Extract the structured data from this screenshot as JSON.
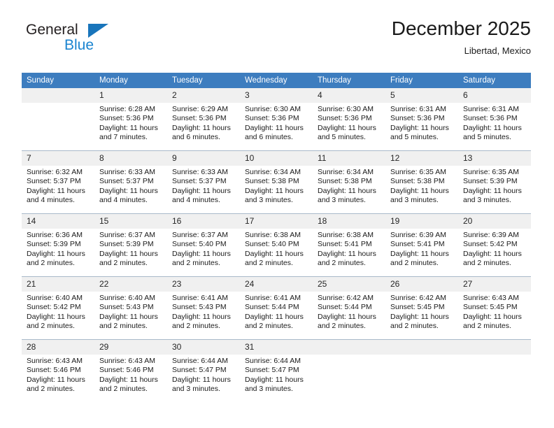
{
  "brand": {
    "name_top": "General",
    "name_bottom": "Blue",
    "triangle_color": "#1975bb",
    "blue_color": "#1b84d0"
  },
  "header": {
    "title": "December 2025",
    "subtitle": "Libertad, Mexico"
  },
  "theme": {
    "header_bg": "#3d7dbf",
    "header_text": "#ffffff",
    "daynum_bg": "#f0f0f0",
    "cell_bg": "#ffffff",
    "grid_line": "#a9b9c9"
  },
  "weekdays": [
    "Sunday",
    "Monday",
    "Tuesday",
    "Wednesday",
    "Thursday",
    "Friday",
    "Saturday"
  ],
  "labels": {
    "sunrise_prefix": "Sunrise:",
    "sunset_prefix": "Sunset:",
    "daylight_prefix": "Daylight:"
  },
  "weeks": [
    [
      {
        "day": "",
        "blank": true
      },
      {
        "day": "1",
        "sunrise": "Sunrise: 6:28 AM",
        "sunset": "Sunset: 5:36 PM",
        "daylight1": "Daylight: 11 hours",
        "daylight2": "and 7 minutes."
      },
      {
        "day": "2",
        "sunrise": "Sunrise: 6:29 AM",
        "sunset": "Sunset: 5:36 PM",
        "daylight1": "Daylight: 11 hours",
        "daylight2": "and 6 minutes."
      },
      {
        "day": "3",
        "sunrise": "Sunrise: 6:30 AM",
        "sunset": "Sunset: 5:36 PM",
        "daylight1": "Daylight: 11 hours",
        "daylight2": "and 6 minutes."
      },
      {
        "day": "4",
        "sunrise": "Sunrise: 6:30 AM",
        "sunset": "Sunset: 5:36 PM",
        "daylight1": "Daylight: 11 hours",
        "daylight2": "and 5 minutes."
      },
      {
        "day": "5",
        "sunrise": "Sunrise: 6:31 AM",
        "sunset": "Sunset: 5:36 PM",
        "daylight1": "Daylight: 11 hours",
        "daylight2": "and 5 minutes."
      },
      {
        "day": "6",
        "sunrise": "Sunrise: 6:31 AM",
        "sunset": "Sunset: 5:36 PM",
        "daylight1": "Daylight: 11 hours",
        "daylight2": "and 5 minutes."
      }
    ],
    [
      {
        "day": "7",
        "sunrise": "Sunrise: 6:32 AM",
        "sunset": "Sunset: 5:37 PM",
        "daylight1": "Daylight: 11 hours",
        "daylight2": "and 4 minutes."
      },
      {
        "day": "8",
        "sunrise": "Sunrise: 6:33 AM",
        "sunset": "Sunset: 5:37 PM",
        "daylight1": "Daylight: 11 hours",
        "daylight2": "and 4 minutes."
      },
      {
        "day": "9",
        "sunrise": "Sunrise: 6:33 AM",
        "sunset": "Sunset: 5:37 PM",
        "daylight1": "Daylight: 11 hours",
        "daylight2": "and 4 minutes."
      },
      {
        "day": "10",
        "sunrise": "Sunrise: 6:34 AM",
        "sunset": "Sunset: 5:38 PM",
        "daylight1": "Daylight: 11 hours",
        "daylight2": "and 3 minutes."
      },
      {
        "day": "11",
        "sunrise": "Sunrise: 6:34 AM",
        "sunset": "Sunset: 5:38 PM",
        "daylight1": "Daylight: 11 hours",
        "daylight2": "and 3 minutes."
      },
      {
        "day": "12",
        "sunrise": "Sunrise: 6:35 AM",
        "sunset": "Sunset: 5:38 PM",
        "daylight1": "Daylight: 11 hours",
        "daylight2": "and 3 minutes."
      },
      {
        "day": "13",
        "sunrise": "Sunrise: 6:35 AM",
        "sunset": "Sunset: 5:39 PM",
        "daylight1": "Daylight: 11 hours",
        "daylight2": "and 3 minutes."
      }
    ],
    [
      {
        "day": "14",
        "sunrise": "Sunrise: 6:36 AM",
        "sunset": "Sunset: 5:39 PM",
        "daylight1": "Daylight: 11 hours",
        "daylight2": "and 2 minutes."
      },
      {
        "day": "15",
        "sunrise": "Sunrise: 6:37 AM",
        "sunset": "Sunset: 5:39 PM",
        "daylight1": "Daylight: 11 hours",
        "daylight2": "and 2 minutes."
      },
      {
        "day": "16",
        "sunrise": "Sunrise: 6:37 AM",
        "sunset": "Sunset: 5:40 PM",
        "daylight1": "Daylight: 11 hours",
        "daylight2": "and 2 minutes."
      },
      {
        "day": "17",
        "sunrise": "Sunrise: 6:38 AM",
        "sunset": "Sunset: 5:40 PM",
        "daylight1": "Daylight: 11 hours",
        "daylight2": "and 2 minutes."
      },
      {
        "day": "18",
        "sunrise": "Sunrise: 6:38 AM",
        "sunset": "Sunset: 5:41 PM",
        "daylight1": "Daylight: 11 hours",
        "daylight2": "and 2 minutes."
      },
      {
        "day": "19",
        "sunrise": "Sunrise: 6:39 AM",
        "sunset": "Sunset: 5:41 PM",
        "daylight1": "Daylight: 11 hours",
        "daylight2": "and 2 minutes."
      },
      {
        "day": "20",
        "sunrise": "Sunrise: 6:39 AM",
        "sunset": "Sunset: 5:42 PM",
        "daylight1": "Daylight: 11 hours",
        "daylight2": "and 2 minutes."
      }
    ],
    [
      {
        "day": "21",
        "sunrise": "Sunrise: 6:40 AM",
        "sunset": "Sunset: 5:42 PM",
        "daylight1": "Daylight: 11 hours",
        "daylight2": "and 2 minutes."
      },
      {
        "day": "22",
        "sunrise": "Sunrise: 6:40 AM",
        "sunset": "Sunset: 5:43 PM",
        "daylight1": "Daylight: 11 hours",
        "daylight2": "and 2 minutes."
      },
      {
        "day": "23",
        "sunrise": "Sunrise: 6:41 AM",
        "sunset": "Sunset: 5:43 PM",
        "daylight1": "Daylight: 11 hours",
        "daylight2": "and 2 minutes."
      },
      {
        "day": "24",
        "sunrise": "Sunrise: 6:41 AM",
        "sunset": "Sunset: 5:44 PM",
        "daylight1": "Daylight: 11 hours",
        "daylight2": "and 2 minutes."
      },
      {
        "day": "25",
        "sunrise": "Sunrise: 6:42 AM",
        "sunset": "Sunset: 5:44 PM",
        "daylight1": "Daylight: 11 hours",
        "daylight2": "and 2 minutes."
      },
      {
        "day": "26",
        "sunrise": "Sunrise: 6:42 AM",
        "sunset": "Sunset: 5:45 PM",
        "daylight1": "Daylight: 11 hours",
        "daylight2": "and 2 minutes."
      },
      {
        "day": "27",
        "sunrise": "Sunrise: 6:43 AM",
        "sunset": "Sunset: 5:45 PM",
        "daylight1": "Daylight: 11 hours",
        "daylight2": "and 2 minutes."
      }
    ],
    [
      {
        "day": "28",
        "sunrise": "Sunrise: 6:43 AM",
        "sunset": "Sunset: 5:46 PM",
        "daylight1": "Daylight: 11 hours",
        "daylight2": "and 2 minutes."
      },
      {
        "day": "29",
        "sunrise": "Sunrise: 6:43 AM",
        "sunset": "Sunset: 5:46 PM",
        "daylight1": "Daylight: 11 hours",
        "daylight2": "and 2 minutes."
      },
      {
        "day": "30",
        "sunrise": "Sunrise: 6:44 AM",
        "sunset": "Sunset: 5:47 PM",
        "daylight1": "Daylight: 11 hours",
        "daylight2": "and 3 minutes."
      },
      {
        "day": "31",
        "sunrise": "Sunrise: 6:44 AM",
        "sunset": "Sunset: 5:47 PM",
        "daylight1": "Daylight: 11 hours",
        "daylight2": "and 3 minutes."
      },
      {
        "day": "",
        "blank": true
      },
      {
        "day": "",
        "blank": true
      },
      {
        "day": "",
        "blank": true
      }
    ]
  ]
}
